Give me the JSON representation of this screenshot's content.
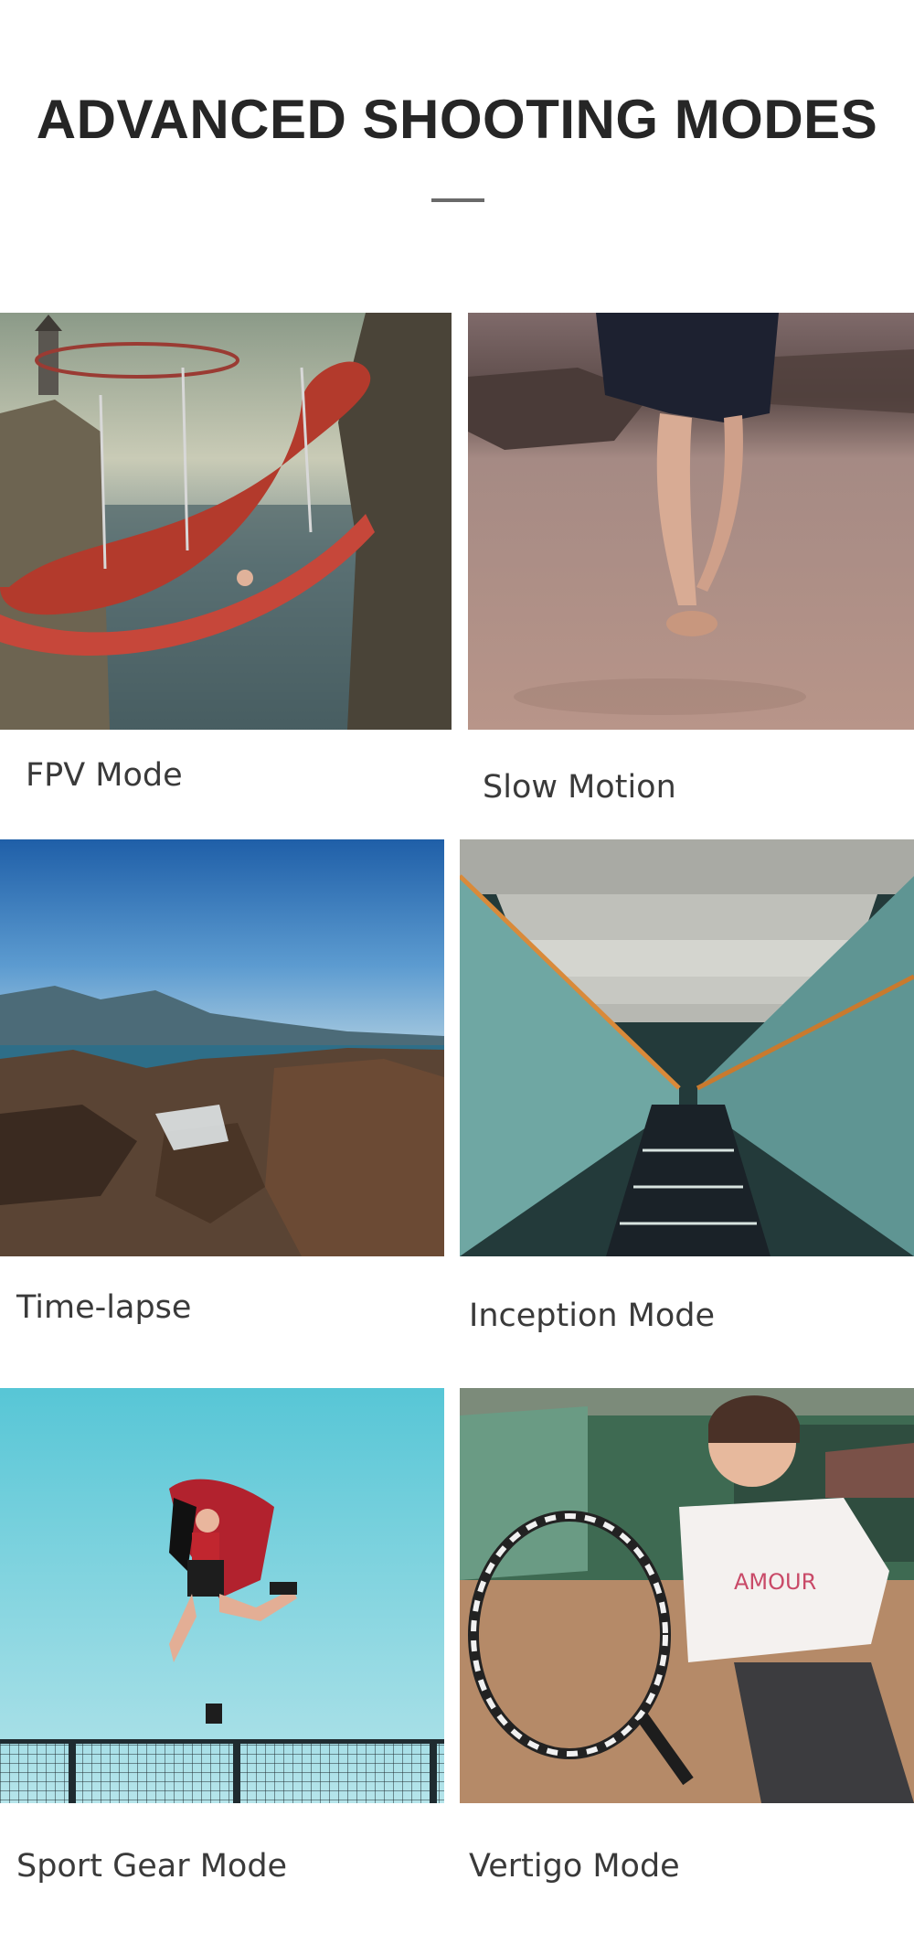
{
  "header": {
    "title": "ADVANCED SHOOTING MODES"
  },
  "modes": [
    {
      "label": "FPV Mode",
      "image": "water-slide-over-sea-photo"
    },
    {
      "label": "Slow Motion",
      "image": "barefoot-walk-on-beach-photo"
    },
    {
      "label": "Time-lapse",
      "image": "rocky-coast-landscape-photo"
    },
    {
      "label": "Inception Mode",
      "image": "escalator-tunnel-photo"
    },
    {
      "label": "Sport Gear Mode",
      "image": "jumping-woman-sky-photo"
    },
    {
      "label": "Vertigo Mode",
      "image": "tennis-player-court-photo"
    }
  ]
}
